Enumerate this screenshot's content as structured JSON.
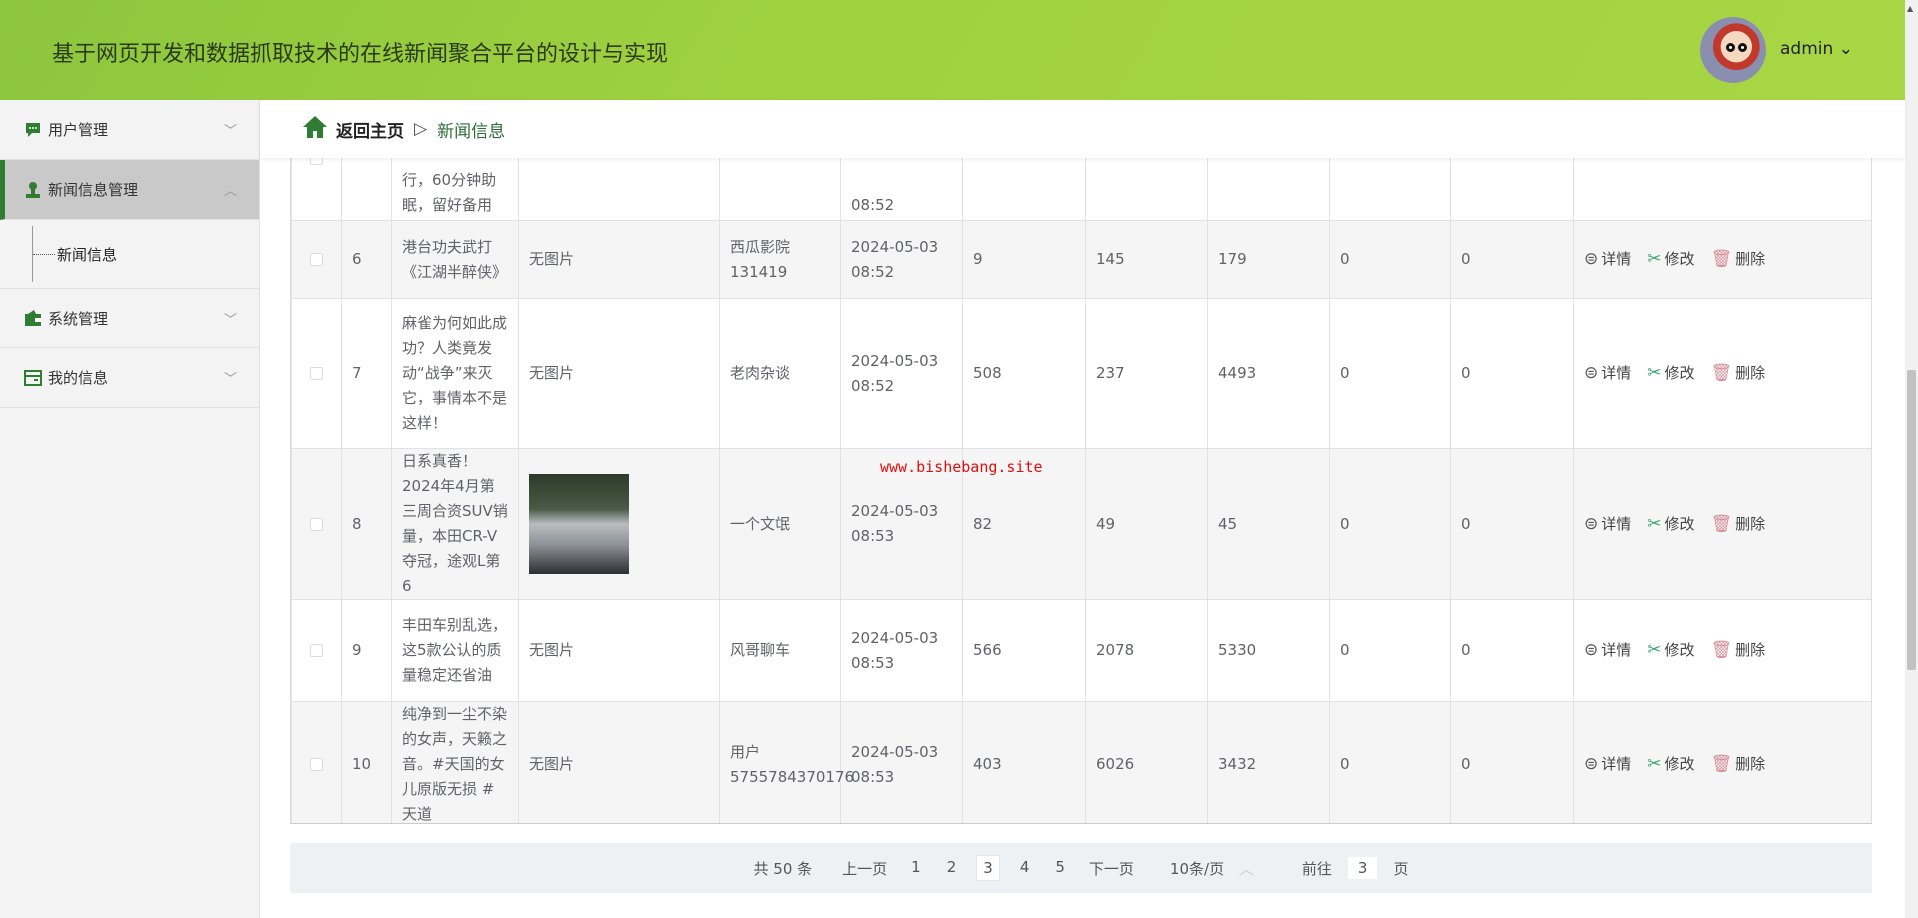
{
  "header": {
    "title": "基于网页开发和数据抓取技术的在线新闻聚合平台的设计与实现",
    "user": "admin",
    "user_chevron": "⌄"
  },
  "sidebar": {
    "items": [
      {
        "label": "用户管理",
        "icon": "chat-icon"
      },
      {
        "label": "新闻信息管理",
        "icon": "user-icon",
        "active": true,
        "children": [
          {
            "label": "新闻信息"
          }
        ]
      },
      {
        "label": "系统管理",
        "icon": "wallet-icon"
      },
      {
        "label": "我的信息",
        "icon": "card-icon"
      }
    ]
  },
  "breadcrumb": {
    "home": "返回主页",
    "separator": "▷",
    "current": "新闻信息"
  },
  "table": {
    "actions": {
      "detail": "详情",
      "edit": "修改",
      "delete": "删除"
    },
    "rows": [
      {
        "index": "",
        "title": "行，60分钟助眠，留好备用",
        "image": "",
        "author": "",
        "time": "08:52",
        "c1": "",
        "c2": "",
        "c3": "",
        "c4": "",
        "c5": "",
        "partial": true
      },
      {
        "index": "6",
        "title": "港台功夫武打《江湖半醉侠》",
        "image": "无图片",
        "author": "西瓜影院131419",
        "time": "2024-05-03 08:52",
        "c1": "9",
        "c2": "145",
        "c3": "179",
        "c4": "0",
        "c5": "0"
      },
      {
        "index": "7",
        "title": "麻雀为何如此成功？人类竟发动“战争”来灭它，事情本不是这样！",
        "image": "无图片",
        "author": "老肉杂谈",
        "time": "2024-05-03 08:52",
        "c1": "508",
        "c2": "237",
        "c3": "4493",
        "c4": "0",
        "c5": "0"
      },
      {
        "index": "8",
        "title": "日系真香！2024年4月第三周合资SUV销量，本田CR-V夺冠，途观L第6",
        "image": "[photo]",
        "author": "一个文氓",
        "time": "2024-05-03 08:53",
        "c1": "82",
        "c2": "49",
        "c3": "45",
        "c4": "0",
        "c5": "0"
      },
      {
        "index": "9",
        "title": "丰田车别乱选，这5款公认的质量稳定还省油",
        "image": "无图片",
        "author": "风哥聊车",
        "time": "2024-05-03 08:53",
        "c1": "566",
        "c2": "2078",
        "c3": "5330",
        "c4": "0",
        "c5": "0"
      },
      {
        "index": "10",
        "title": "纯净到一尘不染的女声，天籁之音。#天国的女儿原版无损 #天道",
        "image": "无图片",
        "author": "用户5755784370176",
        "time": "2024-05-03 08:53",
        "c1": "403",
        "c2": "6026",
        "c3": "3432",
        "c4": "0",
        "c5": "0"
      }
    ]
  },
  "watermark": "www.bishebang.site",
  "pagination": {
    "total": "共 50 条",
    "prev": "上一页",
    "pages": [
      "1",
      "2",
      "3",
      "4",
      "5"
    ],
    "current": "3",
    "next": "下一页",
    "page_size": "10条/页",
    "goto_label": "前往",
    "goto_value": "3",
    "goto_suffix": "页"
  },
  "colors": {
    "header": "#9fd13f",
    "accent": "#2e7d32"
  }
}
